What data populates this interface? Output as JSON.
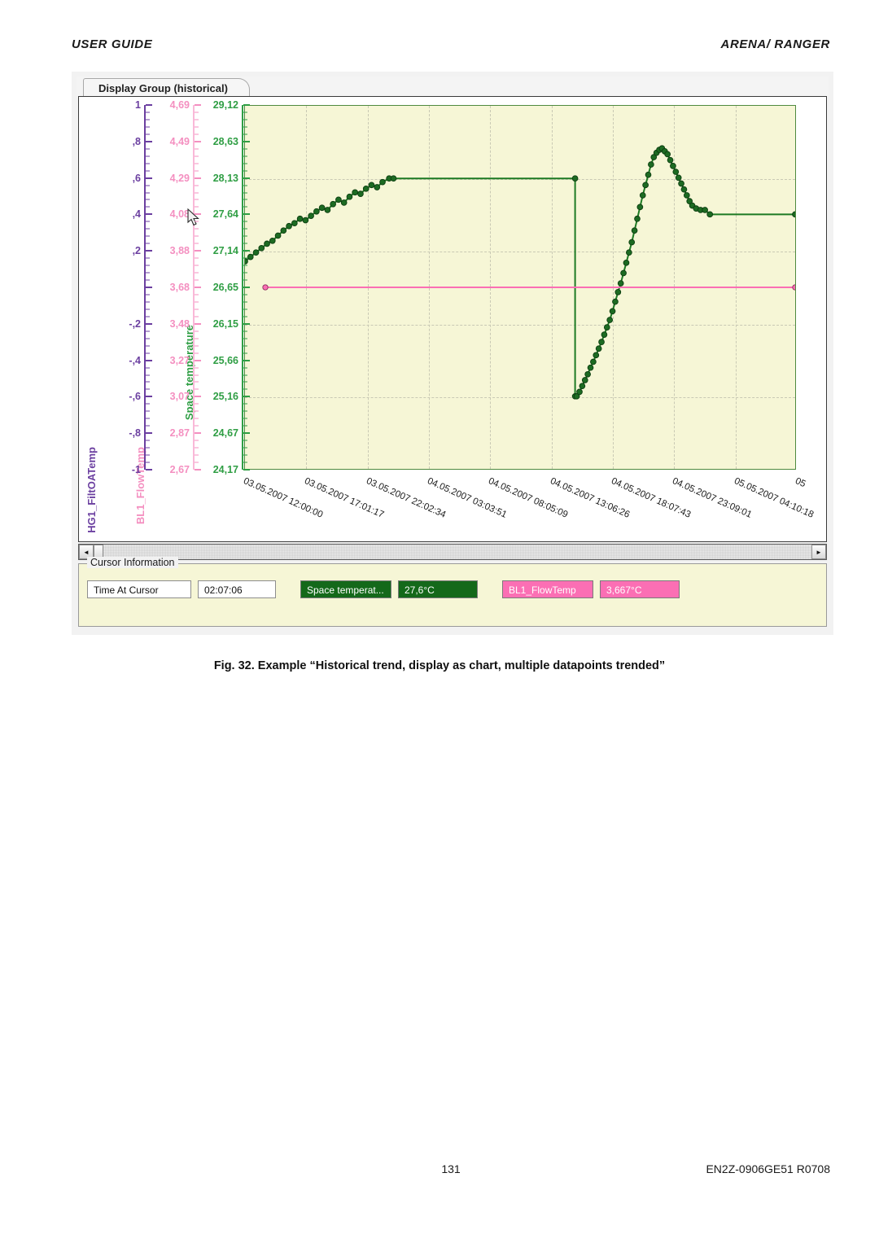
{
  "page": {
    "header_left": "USER GUIDE",
    "header_right": "ARENA/ RANGER",
    "footer_page_number": "131",
    "footer_doc_id": "EN2Z-0906GE51 R0708",
    "figure_caption": "Fig. 32.  Example “Historical trend, display as chart, multiple datapoints trended”"
  },
  "window": {
    "tab_label": "Display Group (historical)"
  },
  "scrollbar": {
    "left_arrow": "◄",
    "right_arrow": "►"
  },
  "cursor_info": {
    "legend": "Cursor Information",
    "time_label": "Time At Cursor",
    "time_value": "02:07:06",
    "dp1_name": "Space temperat...",
    "dp1_value": "27,6°C",
    "dp2_name": "BL1_FlowTemp",
    "dp2_value": "3,667°C",
    "green_color": "#14691a",
    "pink_color": "#fb6fb4"
  },
  "chart_data": {
    "type": "line",
    "title": "Display Group (historical)",
    "xlabel": "",
    "grid": true,
    "legend": "none",
    "plot_background": "#f6f6d6",
    "x_tick_labels": [
      "03.05.2007 12:00:00",
      "03.05.2007 17:01:17",
      "03.05.2007 22:02:34",
      "04.05.2007 03:03:51",
      "04.05.2007 08:05:09",
      "04.05.2007 13:06:26",
      "04.05.2007 18:07:43",
      "04.05.2007 23:09:01",
      "05.05.2007 04:10:18",
      "05"
    ],
    "axes": [
      {
        "name": "HG1_FiltOATemp",
        "color": "#6b3fa0",
        "ticks": [
          "1",
          ",8",
          ",6",
          ",4",
          ",2",
          "",
          "-,2",
          "-,4",
          "-,6",
          "-,8",
          "-1"
        ],
        "range": [
          -1,
          1
        ]
      },
      {
        "name": "BL1_FlowTemp",
        "color": "#f48fc0",
        "ticks": [
          "4,69",
          "4,49",
          "4,29",
          "4,08",
          "3,88",
          "3,68",
          "3,48",
          "3,27",
          "3,07",
          "2,87",
          "2,67"
        ],
        "range": [
          2.67,
          4.69
        ]
      },
      {
        "name": "Space temperature",
        "color": "#2f9e44",
        "ticks": [
          "29,12",
          "28,63",
          "28,13",
          "27,64",
          "27,14",
          "26,65",
          "26,15",
          "25,66",
          "25,16",
          "24,67",
          "24,17"
        ],
        "range": [
          24.17,
          29.12
        ]
      }
    ],
    "series": [
      {
        "name": "Space temperature",
        "color": "#1d7a23",
        "axis": "Space temperature",
        "unit": "°C",
        "marker": "circle",
        "points": [
          {
            "x": 0.0,
            "y": 27.0
          },
          {
            "x": 0.01,
            "y": 27.06
          },
          {
            "x": 0.02,
            "y": 27.12
          },
          {
            "x": 0.03,
            "y": 27.18
          },
          {
            "x": 0.04,
            "y": 27.24
          },
          {
            "x": 0.05,
            "y": 27.28
          },
          {
            "x": 0.06,
            "y": 27.35
          },
          {
            "x": 0.07,
            "y": 27.42
          },
          {
            "x": 0.08,
            "y": 27.48
          },
          {
            "x": 0.09,
            "y": 27.52
          },
          {
            "x": 0.1,
            "y": 27.58
          },
          {
            "x": 0.11,
            "y": 27.56
          },
          {
            "x": 0.12,
            "y": 27.62
          },
          {
            "x": 0.13,
            "y": 27.68
          },
          {
            "x": 0.14,
            "y": 27.73
          },
          {
            "x": 0.15,
            "y": 27.7
          },
          {
            "x": 0.16,
            "y": 27.78
          },
          {
            "x": 0.17,
            "y": 27.84
          },
          {
            "x": 0.18,
            "y": 27.8
          },
          {
            "x": 0.19,
            "y": 27.88
          },
          {
            "x": 0.2,
            "y": 27.94
          },
          {
            "x": 0.21,
            "y": 27.92
          },
          {
            "x": 0.22,
            "y": 27.99
          },
          {
            "x": 0.23,
            "y": 28.04
          },
          {
            "x": 0.24,
            "y": 28.01
          },
          {
            "x": 0.25,
            "y": 28.08
          },
          {
            "x": 0.262,
            "y": 28.13
          },
          {
            "x": 0.27,
            "y": 28.13
          },
          {
            "x": 0.6,
            "y": 28.13
          },
          {
            "x": 0.6,
            "y": 25.16
          },
          {
            "x": 0.603,
            "y": 25.16
          },
          {
            "x": 0.608,
            "y": 25.22
          },
          {
            "x": 0.613,
            "y": 25.3
          },
          {
            "x": 0.618,
            "y": 25.38
          },
          {
            "x": 0.623,
            "y": 25.46
          },
          {
            "x": 0.628,
            "y": 25.55
          },
          {
            "x": 0.633,
            "y": 25.63
          },
          {
            "x": 0.638,
            "y": 25.72
          },
          {
            "x": 0.643,
            "y": 25.81
          },
          {
            "x": 0.648,
            "y": 25.9
          },
          {
            "x": 0.653,
            "y": 26.0
          },
          {
            "x": 0.658,
            "y": 26.1
          },
          {
            "x": 0.663,
            "y": 26.2
          },
          {
            "x": 0.668,
            "y": 26.32
          },
          {
            "x": 0.673,
            "y": 26.45
          },
          {
            "x": 0.678,
            "y": 26.58
          },
          {
            "x": 0.683,
            "y": 26.7
          },
          {
            "x": 0.688,
            "y": 26.84
          },
          {
            "x": 0.693,
            "y": 26.98
          },
          {
            "x": 0.698,
            "y": 27.12
          },
          {
            "x": 0.703,
            "y": 27.26
          },
          {
            "x": 0.708,
            "y": 27.42
          },
          {
            "x": 0.713,
            "y": 27.58
          },
          {
            "x": 0.718,
            "y": 27.74
          },
          {
            "x": 0.723,
            "y": 27.9
          },
          {
            "x": 0.728,
            "y": 28.04
          },
          {
            "x": 0.733,
            "y": 28.18
          },
          {
            "x": 0.738,
            "y": 28.32
          },
          {
            "x": 0.743,
            "y": 28.42
          },
          {
            "x": 0.748,
            "y": 28.48
          },
          {
            "x": 0.753,
            "y": 28.52
          },
          {
            "x": 0.758,
            "y": 28.54
          },
          {
            "x": 0.763,
            "y": 28.5
          },
          {
            "x": 0.768,
            "y": 28.46
          },
          {
            "x": 0.773,
            "y": 28.38
          },
          {
            "x": 0.778,
            "y": 28.3
          },
          {
            "x": 0.783,
            "y": 28.22
          },
          {
            "x": 0.788,
            "y": 28.14
          },
          {
            "x": 0.793,
            "y": 28.06
          },
          {
            "x": 0.798,
            "y": 27.98
          },
          {
            "x": 0.803,
            "y": 27.9
          },
          {
            "x": 0.808,
            "y": 27.82
          },
          {
            "x": 0.813,
            "y": 27.76
          },
          {
            "x": 0.82,
            "y": 27.72
          },
          {
            "x": 0.828,
            "y": 27.7
          },
          {
            "x": 0.836,
            "y": 27.7
          },
          {
            "x": 0.845,
            "y": 27.64
          },
          {
            "x": 1.0,
            "y": 27.64
          }
        ]
      },
      {
        "name": "BL1_FlowTemp",
        "color": "#fb6fb4",
        "axis": "BL1_FlowTemp",
        "unit": "°C",
        "marker": "circle",
        "points": [
          {
            "x": 0.037,
            "y": 3.68
          },
          {
            "x": 0.6,
            "y": 3.68
          },
          {
            "x": 1.0,
            "y": 3.68
          }
        ]
      }
    ]
  }
}
